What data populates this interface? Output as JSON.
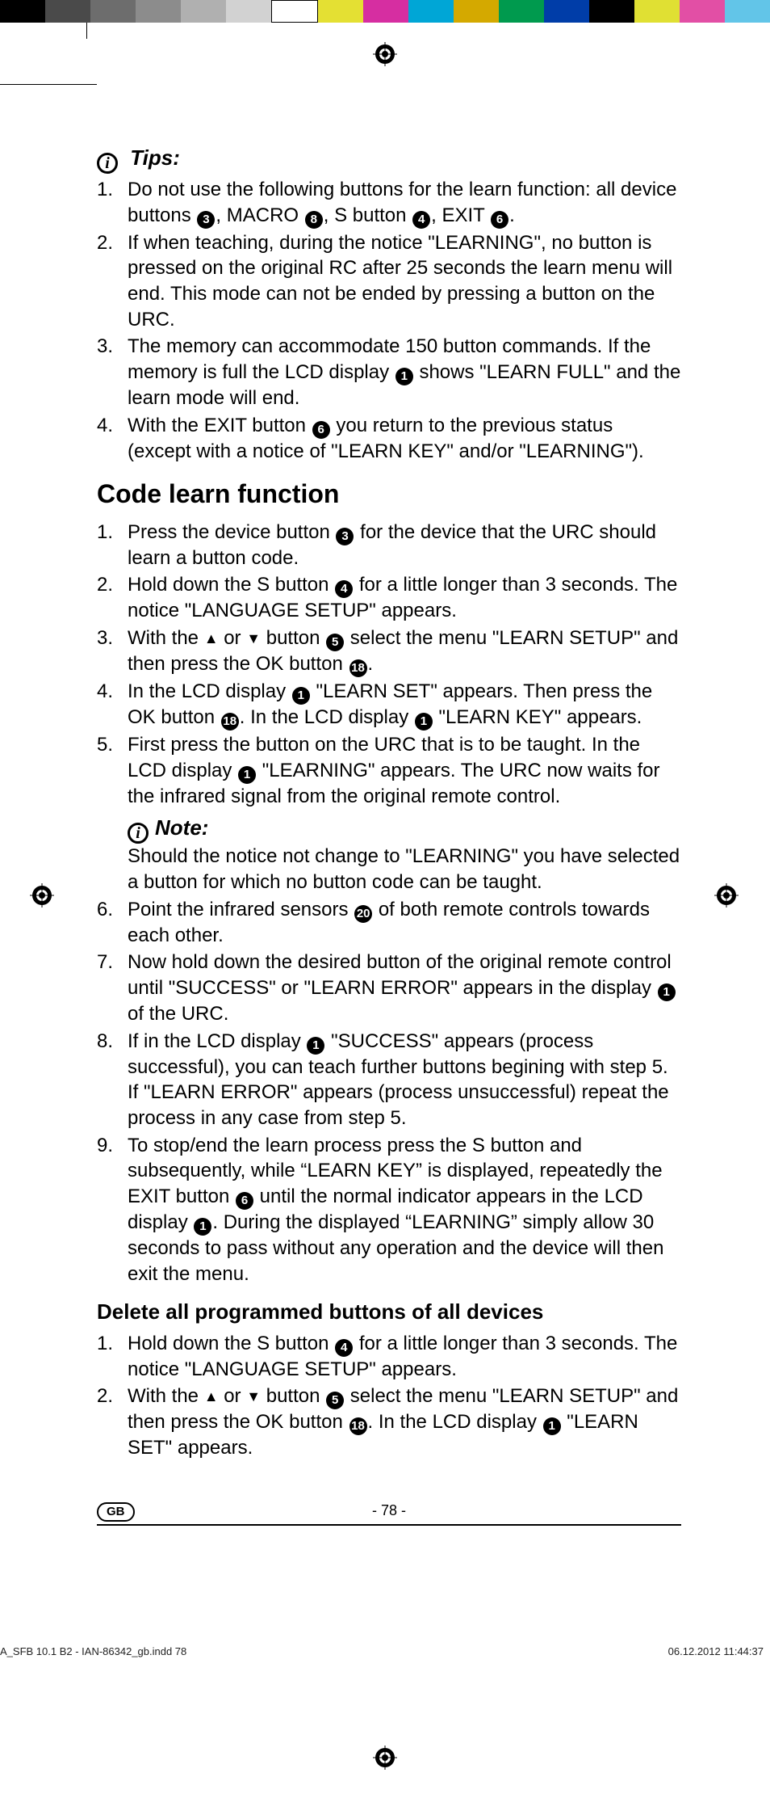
{
  "colorBar": [
    "#000",
    "#4a4a4a",
    "#6d6d6d",
    "#8c8c8c",
    "#b0b0b0",
    "#d2d2d2",
    "#fff",
    "#e4e033",
    "#d62ea1",
    "#00a6d6",
    "#d4a900",
    "#009a4e",
    "#003da8",
    "#000",
    "#e0e033",
    "#e24fa5",
    "#62c5e8"
  ],
  "tips": {
    "heading": "Tips:",
    "items": [
      {
        "pre": "Do not use the following buttons for the learn function: all device buttons ",
        "n1": "3",
        "mid1": ", MACRO ",
        "n2": "8",
        "mid2": ", S button ",
        "n3": "4",
        "mid3": ", EXIT ",
        "n4": "6",
        "post": "."
      },
      {
        "text": "If when teaching, during the notice \"LEARNING\", no button is pressed on the original RC after 25 seconds the learn menu will end. This mode can not be ended by pressing a button on the URC."
      },
      {
        "pre": "The memory can accommodate 150 button commands. If the memory is full the LCD display ",
        "n1": "1",
        "post": " shows \"LEARN FULL\" and the learn mode will end."
      },
      {
        "pre": "With the EXIT button ",
        "n1": "6",
        "post": " you return to the previous status (except with a notice of \"LEARN KEY\" and/or \"LEARNING\")."
      }
    ]
  },
  "codeLearn": {
    "heading": "Code learn function",
    "items": [
      {
        "pre": "Press the device button ",
        "n1": "3",
        "post": " for the device that the URC should learn a button code."
      },
      {
        "pre": "Hold down the S button ",
        "n1": "4",
        "post": " for a little longer than 3 seconds. The notice \"LANGUAGE SETUP\" appears."
      },
      {
        "pre": "With the ",
        "arrUp": "▲",
        "mid1": " or ",
        "arrDown": "▼",
        "mid2": " button ",
        "n1": "5",
        "mid3": " select the menu \"LEARN SETUP\" and then press the OK button ",
        "n2": "18",
        "post": "."
      },
      {
        "pre": "In the LCD display ",
        "n1": "1",
        "mid1": " \"LEARN SET\" appears. Then press the OK button ",
        "n2": "18",
        "mid2": ".  In the LCD display ",
        "n3": "1",
        "post": " \"LEARN KEY\" appears."
      },
      {
        "pre": "First press the button on the URC that is to be taught. In the LCD display ",
        "n1": "1",
        "post": " \"LEARNING\" appears. The URC now waits for the infrared signal from the original remote control."
      },
      {
        "pre": "Point the infrared sensors ",
        "n1": "20",
        "post": " of both remote controls towards each other."
      },
      {
        "pre": "Now hold down the desired button of the original remote control until \"SUCCESS\" or \"LEARN ERROR\" appears in the display ",
        "n1": "1",
        "post": " of the URC."
      },
      {
        "pre": "If in the LCD display ",
        "n1": "1",
        "post": " \"SUCCESS\" appears (process successful), you can teach further buttons begining with step 5. If \"LEARN ERROR\" appears (process unsuccessful) repeat the process in any case from step 5."
      },
      {
        "pre": "To stop/end the learn process press the S button and subsequently, while “LEARN KEY” is displayed, repeatedly the EXIT button ",
        "n1": "6",
        "mid1": " until the normal indicator appears in the LCD display ",
        "n2": "1",
        "post": ". During the displayed “LEARNING” simply allow 30 seconds to pass without any operation and the device will then exit the menu."
      }
    ],
    "note": {
      "heading": "Note:",
      "text": "Should the notice not change to \"LEARNING\" you have selected a button for which no button code can be taught."
    }
  },
  "deleteAll": {
    "heading": "Delete all programmed buttons of all devices",
    "items": [
      {
        "pre": "Hold down the S button ",
        "n1": "4",
        "post": " for a little longer than 3 seconds. The notice \"LANGUAGE SETUP\" appears."
      },
      {
        "pre": "With the ",
        "arrUp": "▲",
        "mid1": " or ",
        "arrDown": "▼",
        "mid2": " button ",
        "n1": "5",
        "mid3": " select the menu \"LEARN SETUP\" and then press the OK button ",
        "n2": "18",
        "mid4": ". In the LCD display ",
        "n3": "1",
        "post": " \"LEARN SET\" appears."
      }
    ]
  },
  "footer": {
    "pageNum": "- 78 -",
    "badge": "GB"
  },
  "imprint": {
    "left": "A_SFB 10.1 B2 - IAN-86342_gb.indd   78",
    "right": "06.12.2012   11:44:37"
  }
}
